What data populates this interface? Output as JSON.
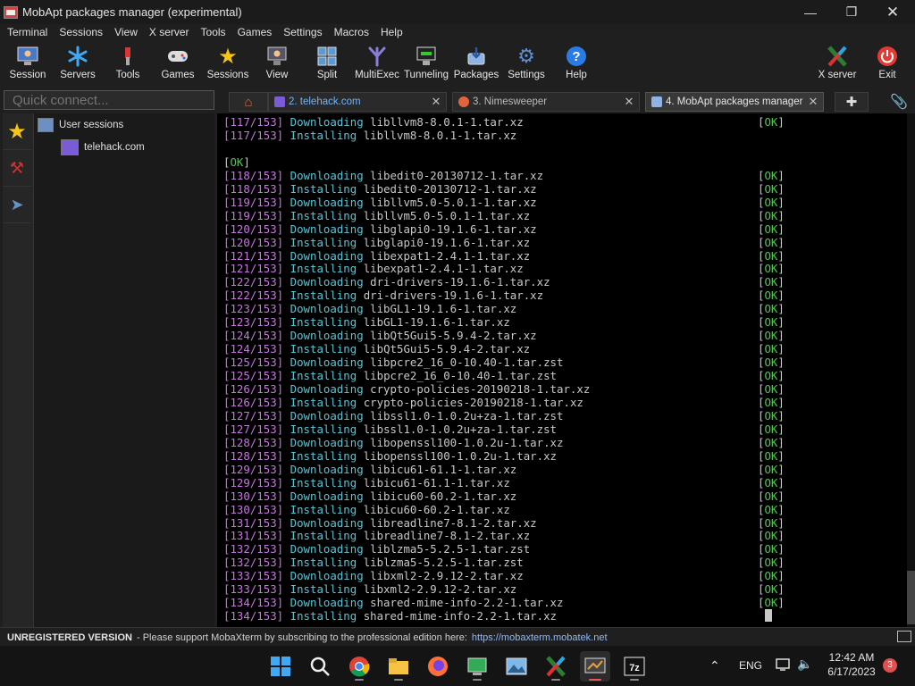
{
  "window": {
    "title": "MobApt packages manager (experimental)"
  },
  "menu": [
    "Terminal",
    "Sessions",
    "View",
    "X server",
    "Tools",
    "Games",
    "Settings",
    "Macros",
    "Help"
  ],
  "toolbar": [
    {
      "label": "Session",
      "icon": "session-icon"
    },
    {
      "label": "Servers",
      "icon": "servers-icon"
    },
    {
      "label": "Tools",
      "icon": "tools-icon"
    },
    {
      "label": "Games",
      "icon": "games-icon"
    },
    {
      "label": "Sessions",
      "icon": "star-icon"
    },
    {
      "label": "View",
      "icon": "view-icon"
    },
    {
      "label": "Split",
      "icon": "split-icon"
    },
    {
      "label": "MultiExec",
      "icon": "multiexec-icon"
    },
    {
      "label": "Tunneling",
      "icon": "tunneling-icon"
    },
    {
      "label": "Packages",
      "icon": "packages-icon"
    },
    {
      "label": "Settings",
      "icon": "settings-icon"
    },
    {
      "label": "Help",
      "icon": "help-icon"
    }
  ],
  "toolbar_right": [
    {
      "label": "X server",
      "icon": "xserver-icon"
    },
    {
      "label": "Exit",
      "icon": "exit-icon"
    }
  ],
  "quick_connect": {
    "placeholder": "Quick connect..."
  },
  "tabs": [
    {
      "label": "2. telehack.com"
    },
    {
      "label": "3. Nimesweeper"
    },
    {
      "label": "4. MobApt packages manager"
    }
  ],
  "sessions_tree": {
    "root": "User sessions",
    "child": "telehack.com"
  },
  "terminal": {
    "top_lines": [
      {
        "num": "[117/153]",
        "action": "Downloading",
        "pkg": "libllvm8-8.0.1-1.tar.xz",
        "ok": "[OK]"
      },
      {
        "num": "[117/153]",
        "action": "Installing",
        "pkg": "libllvm8-8.0.1-1.tar.xz",
        "ok": ""
      }
    ],
    "ok_line": "[OK]",
    "lines": [
      {
        "num": "[118/153]",
        "action": "Downloading",
        "pkg": "libedit0-20130712-1.tar.xz",
        "ok": "[OK]"
      },
      {
        "num": "[118/153]",
        "action": "Installing",
        "pkg": "libedit0-20130712-1.tar.xz",
        "ok": "[OK]"
      },
      {
        "num": "[119/153]",
        "action": "Downloading",
        "pkg": "libllvm5.0-5.0.1-1.tar.xz",
        "ok": "[OK]"
      },
      {
        "num": "[119/153]",
        "action": "Installing",
        "pkg": "libllvm5.0-5.0.1-1.tar.xz",
        "ok": "[OK]"
      },
      {
        "num": "[120/153]",
        "action": "Downloading",
        "pkg": "libglapi0-19.1.6-1.tar.xz",
        "ok": "[OK]"
      },
      {
        "num": "[120/153]",
        "action": "Installing",
        "pkg": "libglapi0-19.1.6-1.tar.xz",
        "ok": "[OK]"
      },
      {
        "num": "[121/153]",
        "action": "Downloading",
        "pkg": "libexpat1-2.4.1-1.tar.xz",
        "ok": "[OK]"
      },
      {
        "num": "[121/153]",
        "action": "Installing",
        "pkg": "libexpat1-2.4.1-1.tar.xz",
        "ok": "[OK]"
      },
      {
        "num": "[122/153]",
        "action": "Downloading",
        "pkg": "dri-drivers-19.1.6-1.tar.xz",
        "ok": "[OK]"
      },
      {
        "num": "[122/153]",
        "action": "Installing",
        "pkg": "dri-drivers-19.1.6-1.tar.xz",
        "ok": "[OK]"
      },
      {
        "num": "[123/153]",
        "action": "Downloading",
        "pkg": "libGL1-19.1.6-1.tar.xz",
        "ok": "[OK]"
      },
      {
        "num": "[123/153]",
        "action": "Installing",
        "pkg": "libGL1-19.1.6-1.tar.xz",
        "ok": "[OK]"
      },
      {
        "num": "[124/153]",
        "action": "Downloading",
        "pkg": "libQt5Gui5-5.9.4-2.tar.xz",
        "ok": "[OK]"
      },
      {
        "num": "[124/153]",
        "action": "Installing",
        "pkg": "libQt5Gui5-5.9.4-2.tar.xz",
        "ok": "[OK]"
      },
      {
        "num": "[125/153]",
        "action": "Downloading",
        "pkg": "libpcre2_16_0-10.40-1.tar.zst",
        "ok": "[OK]"
      },
      {
        "num": "[125/153]",
        "action": "Installing",
        "pkg": "libpcre2_16_0-10.40-1.tar.zst",
        "ok": "[OK]"
      },
      {
        "num": "[126/153]",
        "action": "Downloading",
        "pkg": "crypto-policies-20190218-1.tar.xz",
        "ok": "[OK]"
      },
      {
        "num": "[126/153]",
        "action": "Installing",
        "pkg": "crypto-policies-20190218-1.tar.xz",
        "ok": "[OK]"
      },
      {
        "num": "[127/153]",
        "action": "Downloading",
        "pkg": "libssl1.0-1.0.2u+za-1.tar.zst",
        "ok": "[OK]"
      },
      {
        "num": "[127/153]",
        "action": "Installing",
        "pkg": "libssl1.0-1.0.2u+za-1.tar.zst",
        "ok": "[OK]"
      },
      {
        "num": "[128/153]",
        "action": "Downloading",
        "pkg": "libopenssl100-1.0.2u-1.tar.xz",
        "ok": "[OK]"
      },
      {
        "num": "[128/153]",
        "action": "Installing",
        "pkg": "libopenssl100-1.0.2u-1.tar.xz",
        "ok": "[OK]"
      },
      {
        "num": "[129/153]",
        "action": "Downloading",
        "pkg": "libicu61-61.1-1.tar.xz",
        "ok": "[OK]"
      },
      {
        "num": "[129/153]",
        "action": "Installing",
        "pkg": "libicu61-61.1-1.tar.xz",
        "ok": "[OK]"
      },
      {
        "num": "[130/153]",
        "action": "Downloading",
        "pkg": "libicu60-60.2-1.tar.xz",
        "ok": "[OK]"
      },
      {
        "num": "[130/153]",
        "action": "Installing",
        "pkg": "libicu60-60.2-1.tar.xz",
        "ok": "[OK]"
      },
      {
        "num": "[131/153]",
        "action": "Downloading",
        "pkg": "libreadline7-8.1-2.tar.xz",
        "ok": "[OK]"
      },
      {
        "num": "[131/153]",
        "action": "Installing",
        "pkg": "libreadline7-8.1-2.tar.xz",
        "ok": "[OK]"
      },
      {
        "num": "[132/153]",
        "action": "Downloading",
        "pkg": "liblzma5-5.2.5-1.tar.zst",
        "ok": "[OK]"
      },
      {
        "num": "[132/153]",
        "action": "Installing",
        "pkg": "liblzma5-5.2.5-1.tar.zst",
        "ok": "[OK]"
      },
      {
        "num": "[133/153]",
        "action": "Downloading",
        "pkg": "libxml2-2.9.12-2.tar.xz",
        "ok": "[OK]"
      },
      {
        "num": "[133/153]",
        "action": "Installing",
        "pkg": "libxml2-2.9.12-2.tar.xz",
        "ok": "[OK]"
      },
      {
        "num": "[134/153]",
        "action": "Downloading",
        "pkg": "shared-mime-info-2.2-1.tar.xz",
        "ok": "[OK]"
      },
      {
        "num": "[134/153]",
        "action": "Installing",
        "pkg": "shared-mime-info-2.2-1.tar.xz",
        "ok": ""
      }
    ]
  },
  "status": {
    "unregistered": "UNREGISTERED VERSION",
    "message": "-  Please support MobaXterm by subscribing to the professional edition here:",
    "link": "https://mobaxterm.mobatek.net"
  },
  "taskbar": {
    "apps": [
      "windows-start-icon",
      "search-icon",
      "chrome-icon",
      "file-explorer-icon",
      "firefox-icon",
      "terminal-app-icon",
      "image-viewer-icon",
      "xserver-app-icon",
      "mobaxterm-icon",
      "7zip-icon"
    ],
    "lang": "ENG",
    "time": "12:42 AM",
    "date": "6/17/2023",
    "notifications": "3"
  },
  "colors": {
    "num": "#c678dd",
    "action": "#5ec4d4",
    "ok": "#4ec94e"
  }
}
